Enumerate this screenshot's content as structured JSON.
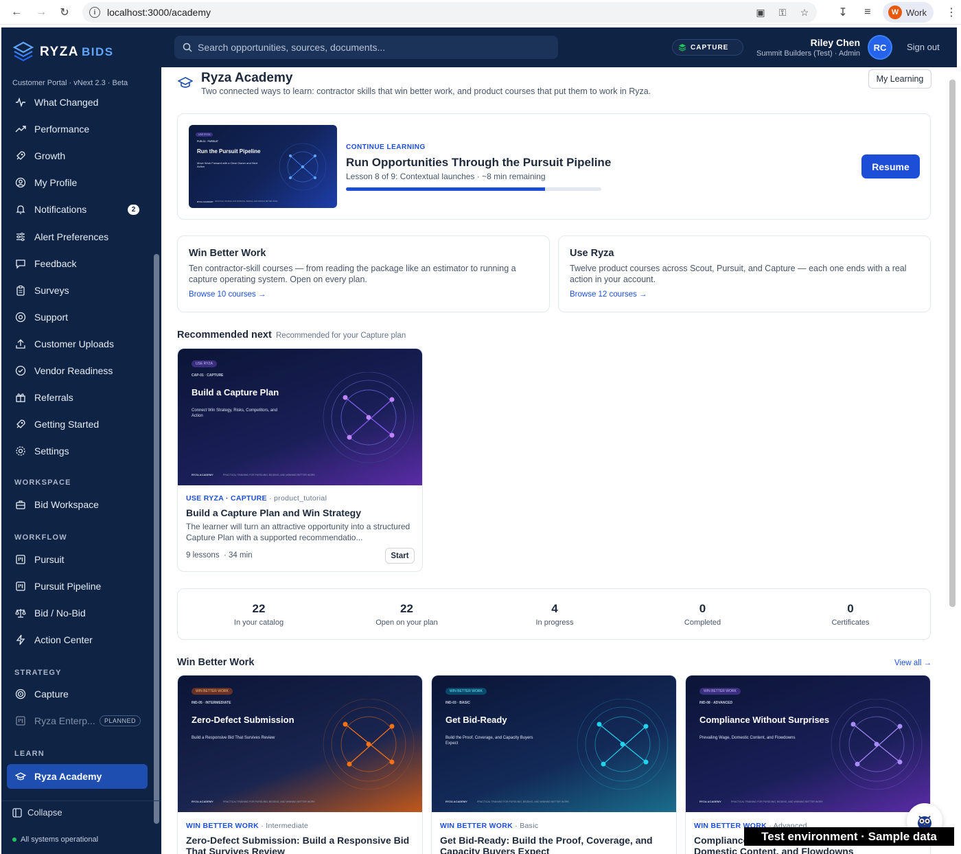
{
  "browser": {
    "url": "localhost:3000/academy",
    "profile_initial": "W",
    "profile_label": "Work"
  },
  "brand": {
    "logo_text": "RYZA",
    "logo_suffix": "BIDS",
    "portal_label": "Customer Portal · vNext 2.3 · Beta",
    "accent": "#1d4ed8",
    "nav_bg": "#0f2344"
  },
  "sidebar": {
    "items": [
      {
        "label": "What Changed",
        "icon": "activity-icon"
      },
      {
        "label": "Performance",
        "icon": "trending-up-icon"
      },
      {
        "label": "Growth",
        "icon": "rocket-icon"
      },
      {
        "label": "My Profile",
        "icon": "user-circle-icon"
      },
      {
        "label": "Notifications",
        "icon": "bell-icon",
        "badge": "2"
      },
      {
        "label": "Alert Preferences",
        "icon": "sliders-icon"
      },
      {
        "label": "Feedback",
        "icon": "message-icon"
      },
      {
        "label": "Surveys",
        "icon": "clipboard-icon"
      },
      {
        "label": "Support",
        "icon": "lifebuoy-icon"
      },
      {
        "label": "Customer Uploads",
        "icon": "upload-icon"
      },
      {
        "label": "Vendor Readiness",
        "icon": "check-circle-icon"
      },
      {
        "label": "Referrals",
        "icon": "gift-icon"
      },
      {
        "label": "Getting Started",
        "icon": "rocket-icon"
      },
      {
        "label": "Settings",
        "icon": "gear-icon"
      }
    ],
    "sections": {
      "workspace": "WORKSPACE",
      "workflow": "WORKFLOW",
      "strategy": "STRATEGY",
      "learn": "LEARN"
    },
    "workspace_items": [
      {
        "label": "Bid Workspace",
        "icon": "briefcase-icon"
      }
    ],
    "workflow_items": [
      {
        "label": "Pursuit",
        "icon": "kanban-icon"
      },
      {
        "label": "Pursuit Pipeline",
        "icon": "kanban-icon"
      },
      {
        "label": "Bid / No-Bid",
        "icon": "scale-icon"
      },
      {
        "label": "Action Center",
        "icon": "bolt-icon"
      }
    ],
    "strategy_items": [
      {
        "label": "Capture",
        "icon": "target-icon"
      },
      {
        "label": "Ryza Enterp...",
        "icon": "kanban-icon",
        "badge": "PLANNED"
      }
    ],
    "learn_items": [
      {
        "label": "Ryza Academy",
        "icon": "graduation-cap-icon"
      }
    ],
    "collapse_label": "Collapse",
    "status_label": "All systems operational"
  },
  "topbar": {
    "search_placeholder": "Search opportunities, sources, documents...",
    "plan_chip": "CAPTURE",
    "user_name": "Riley Chen",
    "user_org": "Summit Builders (Test) · Admin",
    "avatar_initials": "RC",
    "signout_label": "Sign out"
  },
  "page": {
    "title": "Ryza Academy",
    "subtitle": "Two connected ways to learn: contractor skills that win better work, and product courses that put them to work in Ryza.",
    "my_learning_label": "My Learning"
  },
  "continue": {
    "label": "CONTINUE LEARNING",
    "title": "Run Opportunities Through the Pursuit Pipeline",
    "meta": "Lesson 8 of 9: Contextual launches · ~8 min remaining",
    "progress": 0.78,
    "resume_label": "Resume",
    "thumb": {
      "code": "PUR-01 · PURSUIT",
      "title": "Run the Pursuit Pipeline",
      "sub": "Move Work Forward with a Clear Owner and Next Action",
      "foot": "RYZA ACADEMY",
      "foot2": "PRACTICAL TRAINING FOR PURSUING, BIDDING, AND WINNING BETTER WORK"
    }
  },
  "tracks": [
    {
      "title": "Win Better Work",
      "desc": "Ten contractor-skill courses — from reading the package like an estimator to running a capture operating system. Open on every plan.",
      "link": "Browse 10 courses →"
    },
    {
      "title": "Use Ryza",
      "desc": "Twelve product courses across Scout, Pursuit, and Capture — each one ends with a real action in your account.",
      "link": "Browse 12 courses →"
    }
  ],
  "recommended": {
    "title": "Recommended next",
    "subtitle": "Recommended for your Capture plan",
    "course": {
      "thumb_tag": "USE RYZA",
      "thumb_code": "CAP-01 · CAPTURE",
      "thumb_title": "Build a Capture Plan",
      "thumb_sub": "Connect Win Strategy, Risks, Competitors, and Action",
      "thumb_foot": "RYZA ACADEMY",
      "thumb_foot2": "PRACTICAL TRAINING FOR PURSUING, BIDDING, AND WINNING BETTER WORK",
      "kicker": "USE RYZA · CAPTURE",
      "kicker_type": "· product_tutorial",
      "title": "Build a Capture Plan and Win Strategy",
      "desc": "The learner will turn an attractive opportunity into a structured Capture Plan with a supported recommendatio...",
      "lessons": "9 lessons",
      "duration": "· 34 min",
      "start_label": "Start"
    }
  },
  "stats": [
    {
      "value": "22",
      "label": "In your catalog"
    },
    {
      "value": "22",
      "label": "Open on your plan"
    },
    {
      "value": "4",
      "label": "In progress"
    },
    {
      "value": "0",
      "label": "Completed"
    },
    {
      "value": "0",
      "label": "Certificates"
    }
  ],
  "win_better": {
    "title": "Win Better Work",
    "view_all": "View all →",
    "courses": [
      {
        "thumb_tag": "WIN BETTER WORK",
        "thumb_code": "IND-05 · INTERMEDIATE",
        "thumb_title": "Zero-Defect Submission",
        "thumb_sub": "Build a Responsive Bid That Survives Review",
        "kicker": "WIN BETTER WORK",
        "level": "· Intermediate",
        "title": "Zero-Defect Submission: Build a Responsive Bid That Survives Review",
        "style": "orange",
        "node_color": "#f97316"
      },
      {
        "thumb_tag": "WIN BETTER WORK",
        "thumb_code": "IND-03 · BASIC",
        "thumb_title": "Get Bid-Ready",
        "thumb_sub": "Build the Proof, Coverage, and Capacity Buyers Expect",
        "kicker": "WIN BETTER WORK",
        "level": "· Basic",
        "title": "Get Bid-Ready: Build the Proof, Coverage, and Capacity Buyers Expect",
        "style": "teal",
        "node_color": "#22d3ee"
      },
      {
        "thumb_tag": "WIN BETTER WORK",
        "thumb_code": "IND-08 · ADVANCED",
        "thumb_title": "Compliance Without Surprises",
        "thumb_sub": "Prevailing Wage, Domestic Content, and Flowdowns",
        "kicker": "WIN BETTER WORK",
        "level": "· Advanced",
        "title": "Compliance Without Surprises: Prevailing Wage, Domestic Content, and Flowdowns",
        "style": "purple",
        "node_color": "#a78bfa"
      }
    ],
    "thumb_foot": "RYZA ACADEMY",
    "thumb_foot2": "PRACTICAL TRAINING FOR PURSUING, BIDDING, AND WINNING BETTER WORK"
  },
  "banner": "Test environment · Sample data"
}
